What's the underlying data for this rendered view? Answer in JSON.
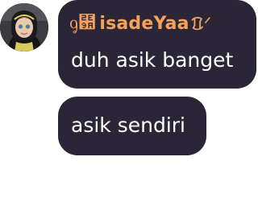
{
  "avatar": {
    "icon": "profile-photo-icon"
  },
  "message_group": {
    "sender": {
      "prefix_glyph": "ᧁ⺚",
      "name": "isadeYaa",
      "suffix_glyph": "ᱯᐟ",
      "name_color": "#f6a15a"
    },
    "messages": [
      {
        "text": "duh asik banget"
      },
      {
        "text": "asik sendiri"
      }
    ],
    "bubble_color": "#2a2637"
  }
}
